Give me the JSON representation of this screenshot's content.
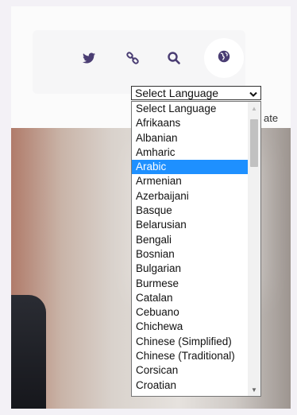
{
  "header_icons": [
    {
      "name": "twitter-icon"
    },
    {
      "name": "link-icon"
    },
    {
      "name": "search-icon"
    },
    {
      "name": "globe-icon"
    }
  ],
  "language_select": {
    "selected": "Select Language",
    "highlighted": "Arabic",
    "options": [
      "Select Language",
      "Afrikaans",
      "Albanian",
      "Amharic",
      "Arabic",
      "Armenian",
      "Azerbaijani",
      "Basque",
      "Belarusian",
      "Bengali",
      "Bosnian",
      "Bulgarian",
      "Burmese",
      "Catalan",
      "Cebuano",
      "Chichewa",
      "Chinese (Simplified)",
      "Chinese (Traditional)",
      "Corsican",
      "Croatian"
    ]
  },
  "side_text": "ate",
  "colors": {
    "icon": "#4a3d73",
    "highlight": "#1e90ff"
  }
}
